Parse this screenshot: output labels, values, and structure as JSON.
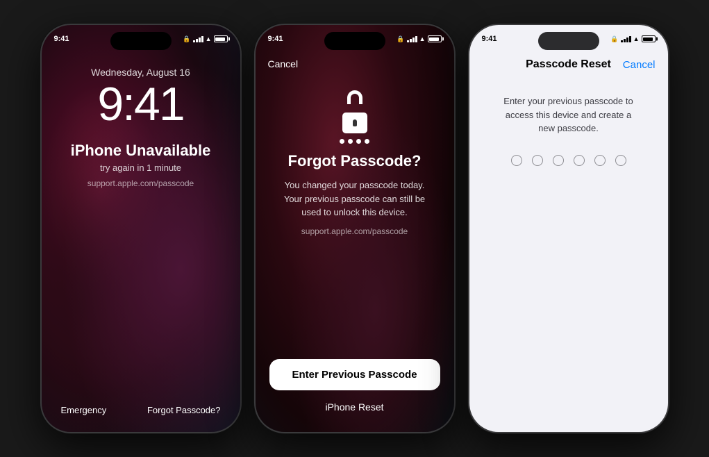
{
  "phone1": {
    "status_time": "9:41",
    "date": "Wednesday, August 16",
    "time": "9:41",
    "title": "iPhone Unavailable",
    "subtitle": "try again in 1 minute",
    "support_link": "support.apple.com/passcode",
    "emergency_btn": "Emergency",
    "forgot_btn": "Forgot Passcode?"
  },
  "phone2": {
    "status_time": "9:41",
    "cancel_btn": "Cancel",
    "title": "Forgot Passcode?",
    "description": "You changed your passcode today. Your previous passcode can still be used to unlock this device.",
    "support_link": "support.apple.com/passcode",
    "enter_btn": "Enter Previous Passcode",
    "reset_btn": "iPhone Reset"
  },
  "phone3": {
    "status_time": "9:41",
    "header_title": "Passcode Reset",
    "cancel_btn": "Cancel",
    "description": "Enter your previous passcode to access this device and create a new passcode.",
    "circle_count": 6
  },
  "colors": {
    "accent": "#007aff",
    "dark_bg": "#1c1c1e"
  }
}
